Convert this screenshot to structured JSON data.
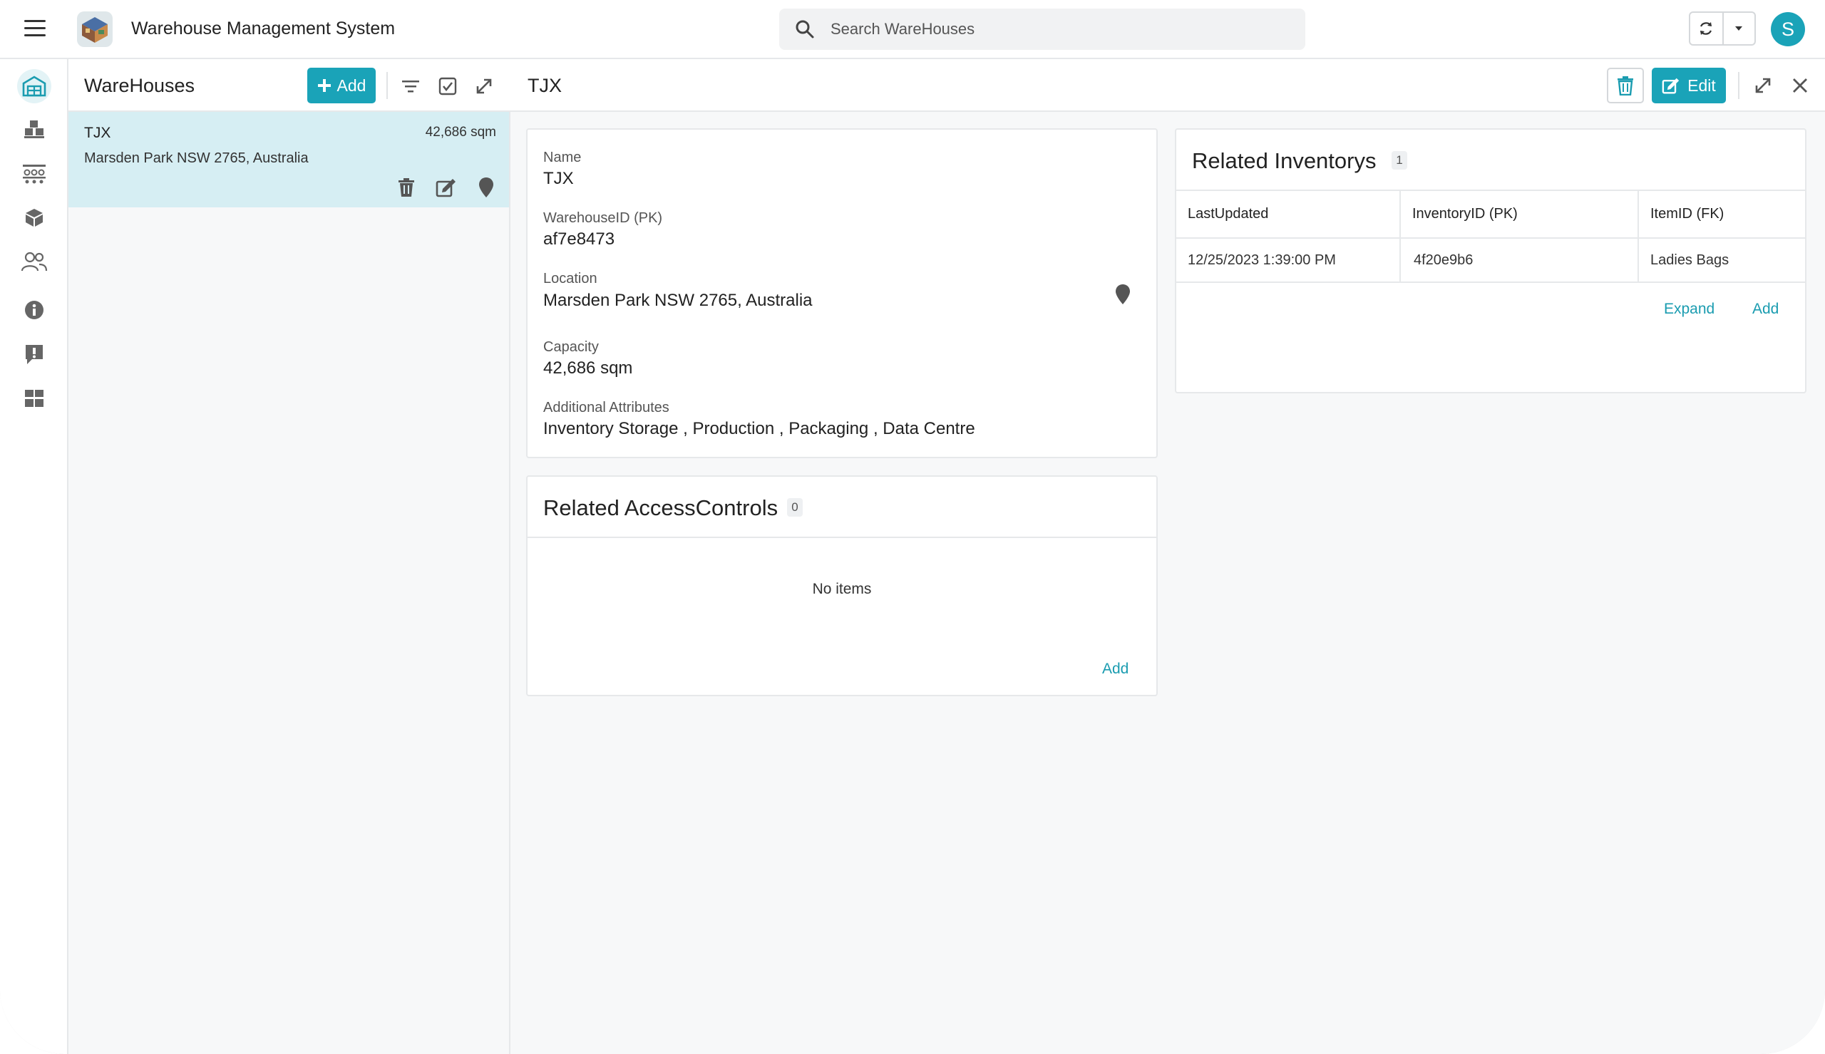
{
  "header": {
    "app_title": "Warehouse Management System",
    "search_placeholder": "Search WareHouses",
    "avatar_initial": "S"
  },
  "rail": {
    "items": [
      {
        "name": "warehouse-icon",
        "active": true
      },
      {
        "name": "pallets-icon"
      },
      {
        "name": "shelves-icon"
      },
      {
        "name": "box-icon"
      },
      {
        "name": "users-icon"
      },
      {
        "name": "info-icon"
      },
      {
        "name": "alert-icon"
      },
      {
        "name": "dashboard-icon"
      }
    ]
  },
  "list": {
    "title": "WareHouses",
    "add_label": "Add",
    "items": [
      {
        "name": "TJX",
        "capacity": "42,686 sqm",
        "location": "Marsden Park NSW 2765, Australia"
      }
    ]
  },
  "detail": {
    "title": "TJX",
    "edit_label": "Edit",
    "fields": {
      "name_label": "Name",
      "name_value": "TJX",
      "id_label": "WarehouseID (PK)",
      "id_value": "af7e8473",
      "location_label": "Location",
      "location_value": "Marsden Park NSW 2765, Australia",
      "capacity_label": "Capacity",
      "capacity_value": "42,686 sqm",
      "attrs_label": "Additional Attributes",
      "attrs_value": "Inventory Storage , Production , Packaging , Data Centre"
    },
    "access_controls": {
      "title": "Related AccessControls",
      "count": "0",
      "empty_text": "No items",
      "add_label": "Add"
    },
    "inventorys": {
      "title": "Related Inventorys",
      "count": "1",
      "columns": [
        "LastUpdated",
        "InventoryID (PK)",
        "ItemID (FK)"
      ],
      "rows": [
        [
          "12/25/2023 1:39:00 PM",
          "4f20e9b6",
          "Ladies Bags"
        ]
      ],
      "expand_label": "Expand",
      "add_label": "Add"
    }
  },
  "colors": {
    "accent": "#1aa3b8",
    "selected_row": "#d6eef3"
  }
}
